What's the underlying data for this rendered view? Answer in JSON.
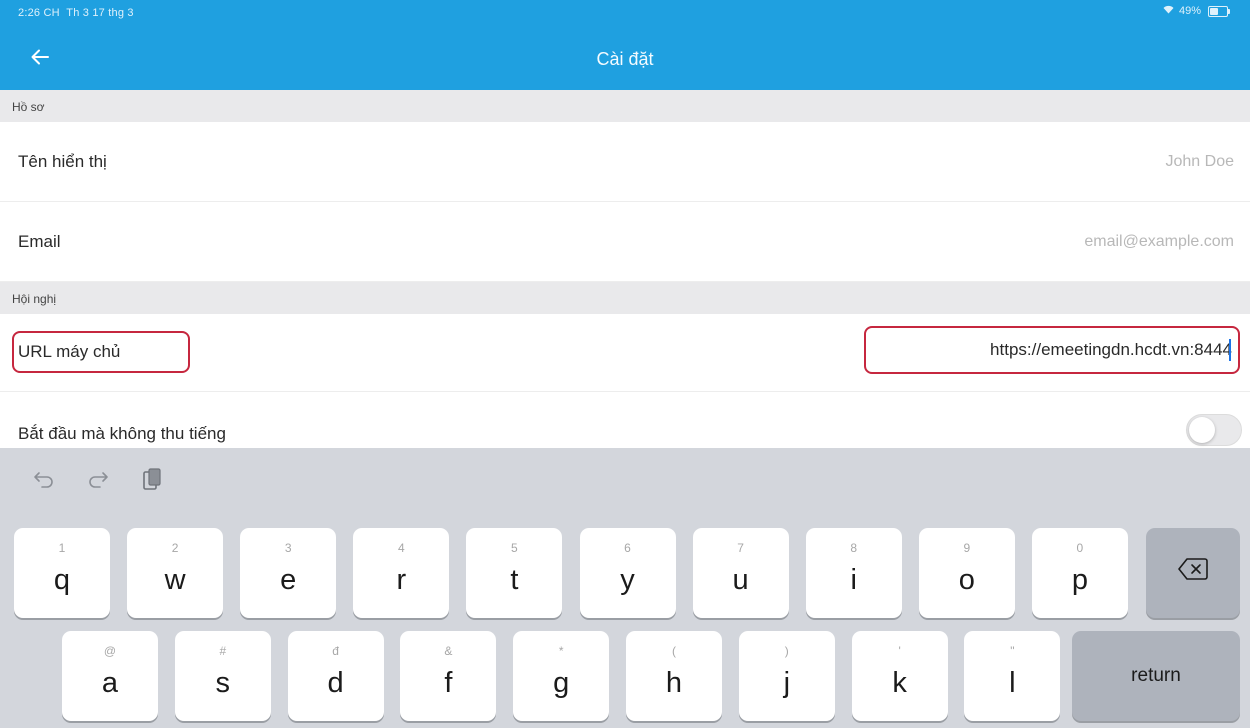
{
  "status_bar": {
    "time": "2:26 CH",
    "date": "Th 3 17 thg 3",
    "battery": "49%",
    "wifi_icon": "wifi-icon",
    "battery_icon": "battery-icon"
  },
  "app_bar": {
    "title": "Cài đặt",
    "back_icon": "arrow-left-icon"
  },
  "sections": {
    "profile": {
      "header": "Hồ sơ",
      "display_name": {
        "label": "Tên hiển thị",
        "placeholder": "John Doe",
        "value": ""
      },
      "email": {
        "label": "Email",
        "placeholder": "email@example.com",
        "value": ""
      }
    },
    "conference": {
      "header": "Hội nghị",
      "server_url": {
        "label": "URL máy chủ",
        "value": "https://emeetingdn.hcdt.vn:8444"
      },
      "start_muted": {
        "label": "Bắt đầu mà không thu tiếng",
        "enabled": false
      }
    }
  },
  "highlight_color": "#c6273f",
  "accent_color": "#1fa0e0",
  "keyboard": {
    "toolbar": [
      "undo-icon",
      "redo-icon",
      "paste-icon"
    ],
    "row1": [
      {
        "hint": "1",
        "char": "q"
      },
      {
        "hint": "2",
        "char": "w"
      },
      {
        "hint": "3",
        "char": "e"
      },
      {
        "hint": "4",
        "char": "r"
      },
      {
        "hint": "5",
        "char": "t"
      },
      {
        "hint": "6",
        "char": "y"
      },
      {
        "hint": "7",
        "char": "u"
      },
      {
        "hint": "8",
        "char": "i"
      },
      {
        "hint": "9",
        "char": "o"
      },
      {
        "hint": "0",
        "char": "p"
      }
    ],
    "row2": [
      {
        "hint": "@",
        "char": "a"
      },
      {
        "hint": "#",
        "char": "s"
      },
      {
        "hint": "đ",
        "char": "d"
      },
      {
        "hint": "&",
        "char": "f"
      },
      {
        "hint": "*",
        "char": "g"
      },
      {
        "hint": "(",
        "char": "h"
      },
      {
        "hint": ")",
        "char": "j"
      },
      {
        "hint": "'",
        "char": "k"
      },
      {
        "hint": "\"",
        "char": "l"
      }
    ],
    "delete_icon": "backspace-icon",
    "return_label": "return"
  }
}
